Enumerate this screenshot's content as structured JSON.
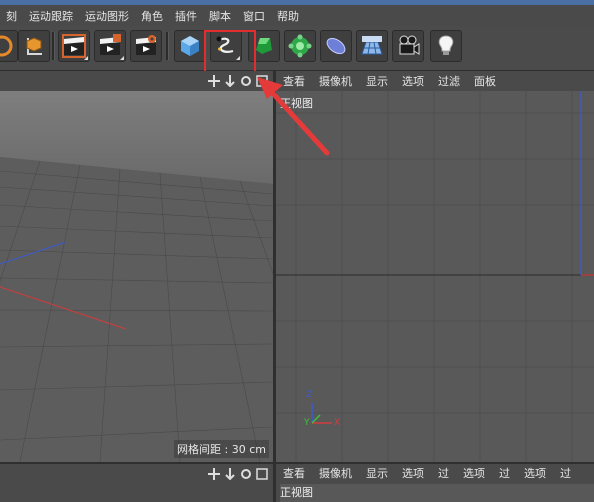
{
  "menu": {
    "items": [
      "刻",
      "运动跟踪",
      "运动图形",
      "角色",
      "插件",
      "脚本",
      "窗口",
      "帮助"
    ]
  },
  "toolbar": {
    "buttons": [
      "render-region",
      "render-view",
      "render-settings",
      "cube",
      "pen",
      "extrude",
      "gear",
      "deformer",
      "floor",
      "camera",
      "light"
    ]
  },
  "left_viewport": {
    "grid_spacing": "网格间距 : 30 cm"
  },
  "right_viewport": {
    "menu": [
      "查看",
      "摄像机",
      "显示",
      "选项",
      "过滤",
      "面板"
    ],
    "view_label": "正视图",
    "axis_labels": {
      "y": "Y",
      "x": "X",
      "z": "Z"
    }
  },
  "bottom_right": {
    "menu": [
      "查看",
      "摄像机",
      "显示",
      "选项",
      "过",
      "选项",
      "过",
      "选项",
      "过"
    ],
    "view_label": "正视图"
  },
  "colors": {
    "highlight": "#e32c2c",
    "arrow": "#e53a3a",
    "axis_x": "#d23c3c",
    "axis_y": "#3cc23c",
    "axis_z": "#3c5ad2"
  }
}
